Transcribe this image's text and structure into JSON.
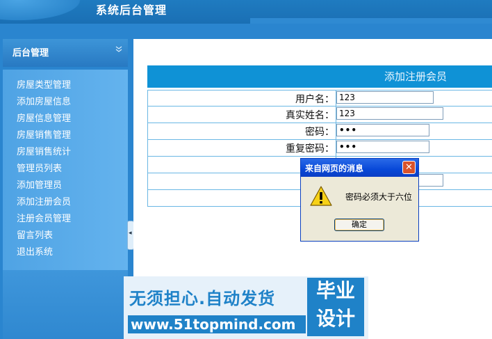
{
  "header": {
    "title": "系统后台管理"
  },
  "sidebar": {
    "panel_title": "后台管理",
    "collapse_icon": "double-chevron-down-icon",
    "items": [
      {
        "label": "房屋类型管理"
      },
      {
        "label": "添加房屋信息"
      },
      {
        "label": "房屋信息管理"
      },
      {
        "label": "房屋销售管理"
      },
      {
        "label": "房屋销售统计"
      },
      {
        "label": "管理员列表"
      },
      {
        "label": "添加管理员"
      },
      {
        "label": "添加注册会员"
      },
      {
        "label": "注册会员管理"
      },
      {
        "label": "留言列表"
      },
      {
        "label": "退出系统"
      }
    ]
  },
  "form": {
    "caption": "添加注册会员",
    "fields": [
      {
        "label": "用户名：",
        "value": "123"
      },
      {
        "label": "真实姓名：",
        "value": "123"
      },
      {
        "label": "密码：",
        "value": "•••"
      },
      {
        "label": "重复密码：",
        "value": "•••"
      }
    ]
  },
  "dialog": {
    "title": "来自网页的消息",
    "icon": "warning-icon",
    "message": "密码必须大于六位",
    "ok_label": "确定",
    "close_glyph": "✕"
  },
  "watermark": {
    "line1": "无须担心.自动发货",
    "line2": "www.51topmind.com",
    "badge_line1": "毕业",
    "badge_line2": "设计"
  },
  "colors": {
    "header_blue": "#1a6fb4",
    "sidebar_blue": "#2a85cf",
    "caption_blue": "#0f92d6",
    "dialog_title": "#0848d8"
  }
}
